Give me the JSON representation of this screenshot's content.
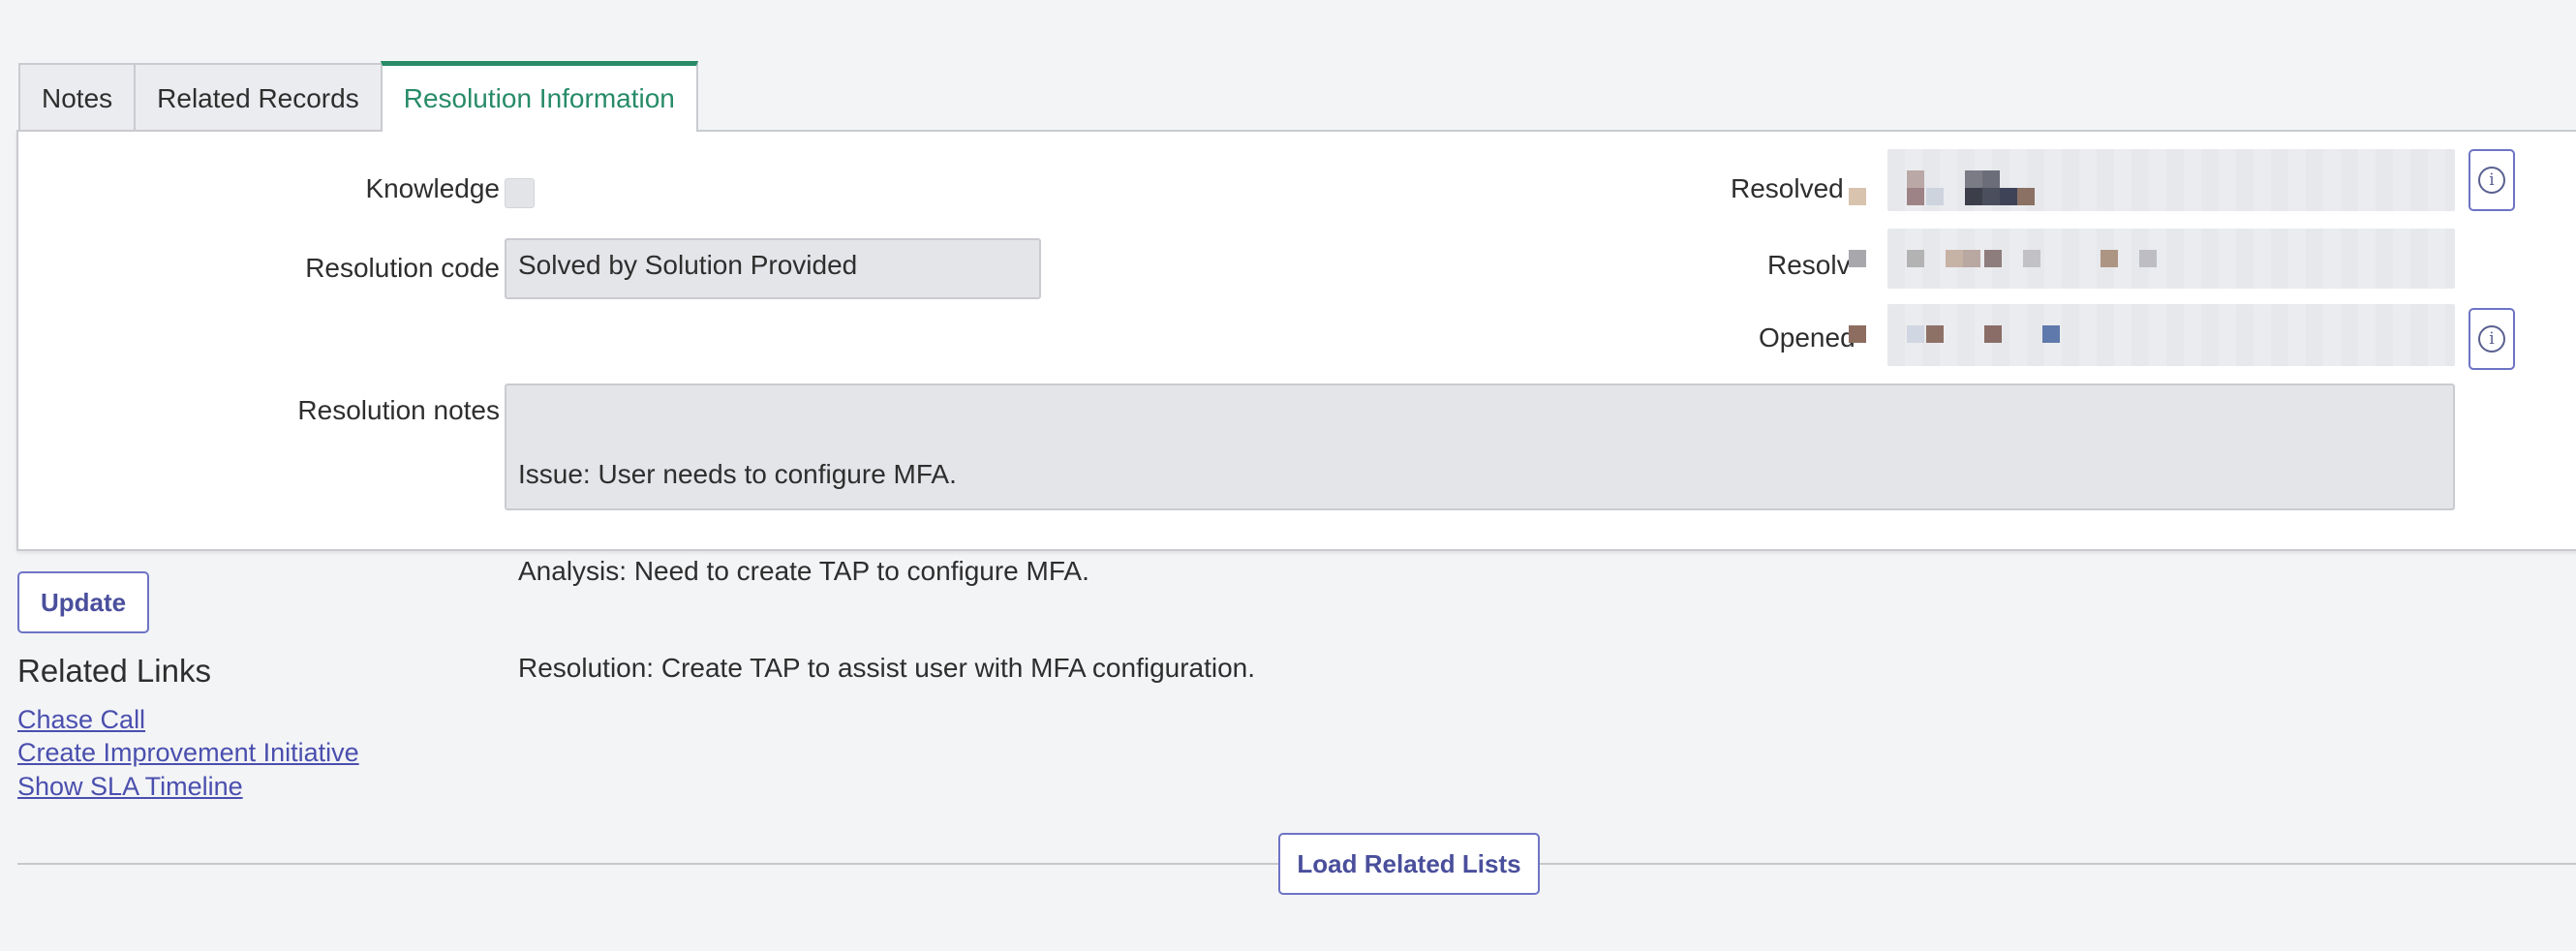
{
  "tabs": [
    {
      "label": "Notes"
    },
    {
      "label": "Related Records"
    },
    {
      "label": "Resolution Information"
    }
  ],
  "form": {
    "knowledge_label": "Knowledge",
    "resolution_code_label": "Resolution code",
    "resolution_code_value": "Solved by Solution Provided",
    "resolution_notes_label": "Resolution notes",
    "resolution_notes_lines": [
      "Issue: User needs to configure MFA.",
      "Analysis: Need to create TAP to configure MFA.",
      "Resolution: Create TAP to assist user with MFA configuration."
    ],
    "resolved_by_label": "Resolved",
    "resolved_label": "Resolv",
    "opened_label": "Opened"
  },
  "actions": {
    "update_label": "Update",
    "load_related_lists_label": "Load Related Lists"
  },
  "related_links": {
    "title": "Related Links",
    "items": [
      "Chase Call",
      "Create Improvement Initiative",
      "Show SLA Timeline"
    ]
  },
  "icons": {
    "info": "info-icon"
  },
  "colors": {
    "active_tab": "#278b67",
    "button_border": "#6d74c5",
    "link": "#4a4fae"
  }
}
